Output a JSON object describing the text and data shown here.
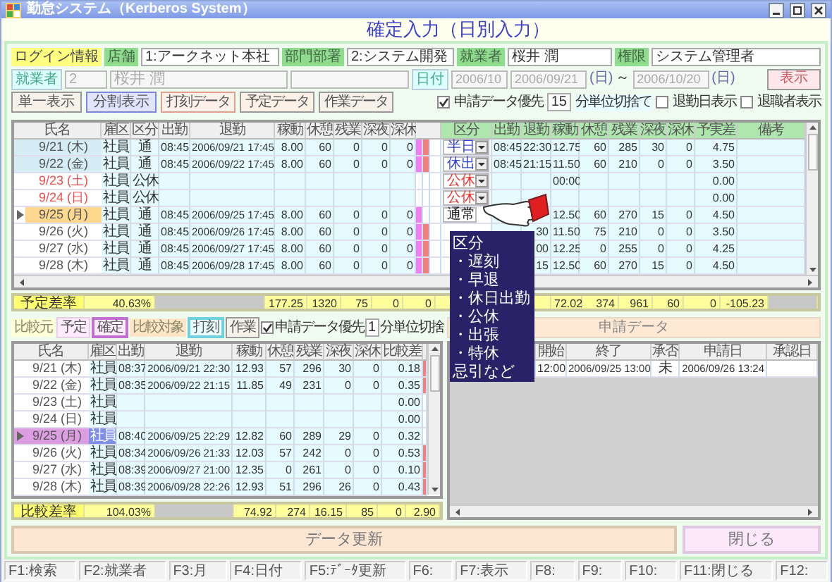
{
  "window": {
    "title": "勤怠システム（Kerberos System）"
  },
  "screen_title": "確定入力（日別入力）",
  "login_info": {
    "label": "ログイン情報",
    "fields": [
      {
        "label": "店舗",
        "value": "1:アークネット本社"
      },
      {
        "label": "部門部署",
        "value": "2:システム開発"
      },
      {
        "label": "就業者",
        "value": "桜井 潤"
      },
      {
        "label": "権限",
        "value": "システム管理者"
      }
    ]
  },
  "filter": {
    "employee_label": "就業者",
    "employee_code": "2",
    "employee_name": "桜井 潤",
    "date_label": "日付",
    "month": "2006/10",
    "date_from": "2006/09/21",
    "from_weekday": "(日)",
    "range_separator": "～",
    "date_to": "2006/10/20",
    "to_weekday": "(日)",
    "show_button": "表示"
  },
  "view_buttons": [
    {
      "label": "単一表示",
      "selected": false
    },
    {
      "label": "分割表示",
      "selected": true
    }
  ],
  "data_buttons": [
    "打刻データ",
    "予定データ",
    "作業データ"
  ],
  "options": {
    "prefer_requests": {
      "label": "申請データ優先",
      "checked": true
    },
    "rounding_value": "15",
    "rounding_label": "分単位切捨て",
    "toggles": [
      {
        "label": "退勤日表示",
        "checked": false
      },
      {
        "label": "退職者表示",
        "checked": false
      }
    ]
  },
  "upper_table": {
    "columns": [
      "氏名",
      "雇区",
      "区分",
      "出勤",
      "退勤",
      "稼動",
      "休憩",
      "残業",
      "深夜",
      "深休"
    ],
    "category_column": "区分",
    "detail_columns": [
      "出勤",
      "退勤",
      "稼動",
      "休憩",
      "残業",
      "深夜",
      "深休",
      "予実差",
      "備考"
    ],
    "rows": [
      {
        "selected": true,
        "current": false,
        "holiday": false,
        "cells": [
          "9/21 (木)",
          "社員",
          "通",
          "08:45",
          "2006/09/21 17:45",
          "8.00",
          "60",
          "0",
          "0",
          "0"
        ],
        "marks": [
          {
            "color": "#f080f0"
          },
          {
            "color": "#f08080"
          }
        ],
        "category": {
          "kind": "dropdown",
          "text": "半日",
          "color": "#3344cc"
        },
        "detail": {
          "in": "08:45",
          "out": "22:30",
          "work": "12.75",
          "rest": "60",
          "overtime": "285",
          "night": "30",
          "night_off": "0",
          "diff": "4.75"
        }
      },
      {
        "selected": true,
        "current": false,
        "holiday": false,
        "cells": [
          "9/22 (金)",
          "社員",
          "通",
          "08:45",
          "2006/09/22 17:45",
          "8.00",
          "60",
          "0",
          "0",
          "0"
        ],
        "marks": [
          {
            "color": "#f080f0"
          },
          {
            "color": "#f08080"
          }
        ],
        "category": {
          "kind": "dropdown",
          "text": "休出",
          "color": "#3344cc"
        },
        "detail": {
          "in": "08:45",
          "out": "21:15",
          "work": "11.50",
          "rest": "60",
          "overtime": "210",
          "night": "0",
          "night_off": "0",
          "diff": "3.50"
        }
      },
      {
        "selected": false,
        "current": false,
        "holiday": true,
        "cells": [
          "9/23 (土)",
          "社員",
          "公休"
        ],
        "category": {
          "kind": "dropdown",
          "text": "公休",
          "color": "#ee3333"
        },
        "detail": {
          "work": "00:00",
          "diff": "0.00"
        }
      },
      {
        "selected": false,
        "current": false,
        "holiday": true,
        "cells": [
          "9/24 (日)",
          "社員",
          "公休"
        ],
        "category": {
          "kind": "dropdown",
          "text": "公休",
          "color": "#ee3333"
        },
        "detail": {
          "diff": "0.00"
        }
      },
      {
        "selected": false,
        "current": true,
        "holiday": false,
        "cells": [
          "9/25 (月)",
          "社員",
          "通",
          "08:45",
          "2006/09/25 17:45",
          "8.00",
          "60",
          "0",
          "0",
          "0"
        ],
        "marks": [
          {
            "color": "#f080f0"
          }
        ],
        "category": {
          "kind": "text",
          "text": "通常",
          "color": "#222222"
        },
        "detail": {
          "work": "12.50",
          "rest": "60",
          "overtime": "270",
          "night": "15",
          "night_off": "0",
          "diff": "4.50"
        }
      },
      {
        "selected": false,
        "current": false,
        "holiday": false,
        "cells": [
          "9/26 (火)",
          "社員",
          "通",
          "08:45",
          "2006/09/26 17:45",
          "8.00",
          "60",
          "0",
          "0",
          "0"
        ],
        "marks": [
          {
            "color": "#f080f0"
          },
          {
            "color": "#f08080"
          }
        ],
        "detail": {
          "out": "30",
          "work": "11.50",
          "rest": "75",
          "overtime": "210",
          "night": "0",
          "night_off": "0",
          "diff": "3.50"
        }
      },
      {
        "selected": false,
        "current": false,
        "holiday": false,
        "cells": [
          "9/27 (水)",
          "社員",
          "通",
          "08:45",
          "2006/09/27 17:45",
          "8.00",
          "60",
          "0",
          "0",
          "0"
        ],
        "marks": [
          {
            "color": "#f080f0"
          },
          {
            "color": "#f08080"
          }
        ],
        "detail": {
          "out": "00",
          "work": "12.25",
          "rest": "0",
          "overtime": "255",
          "night": "0",
          "night_off": "0",
          "diff": "4.25"
        }
      },
      {
        "selected": false,
        "current": false,
        "holiday": false,
        "cells": [
          "9/28 (木)",
          "社員",
          "通",
          "08:45",
          "2006/09/28 17:45",
          "8.00",
          "60",
          "0",
          "0",
          "0"
        ],
        "marks": [
          {
            "color": "#f080f0"
          },
          {
            "color": "#f08080"
          }
        ],
        "detail": {
          "out": "15",
          "work": "12.50",
          "rest": "60",
          "overtime": "270",
          "night": "15",
          "night_off": "0",
          "diff": "4.50"
        }
      }
    ]
  },
  "upper_summary": {
    "label": "予定差率",
    "rate": "40.63%",
    "values": [
      "177.25",
      "1320",
      "75",
      "0",
      "0"
    ],
    "detail_values": [
      "72.02",
      "374",
      "961",
      "60",
      "0",
      "-105.23"
    ]
  },
  "compare": {
    "source_label": "比較元",
    "sources": [
      {
        "label": "予定",
        "selected": false
      },
      {
        "label": "確定",
        "selected": true
      }
    ],
    "target_label": "比較対象",
    "targets": [
      {
        "label": "打刻",
        "selected": true
      },
      {
        "label": "作業",
        "selected": false
      }
    ],
    "prefer_requests": {
      "label": "申請データ優先",
      "checked": true
    },
    "rounding_value": "1",
    "rounding_label": "分単位切捨"
  },
  "lower_table": {
    "columns": [
      "氏名",
      "雇区",
      "出勤",
      "退勤",
      "稼動",
      "休憩",
      "残業",
      "深夜",
      "深休",
      "比較差"
    ],
    "rows": [
      {
        "current": false,
        "cell_selected": false,
        "cells": [
          "9/21 (木)",
          "社員",
          "08:37",
          "2006/09/21 22:30",
          "12.93",
          "57",
          "296",
          "30",
          "0",
          "0.18"
        ],
        "marks": [
          {
            "color": "#f08080"
          }
        ]
      },
      {
        "current": false,
        "cell_selected": false,
        "cells": [
          "9/22 (金)",
          "社員",
          "08:35",
          "2006/09/22 21:15",
          "11.85",
          "49",
          "231",
          "0",
          "0",
          "0.35"
        ],
        "marks": [
          {
            "color": "#f08080"
          }
        ]
      },
      {
        "current": false,
        "cell_selected": false,
        "cells": [
          "9/23 (土)",
          "社員"
        ],
        "difference": "0.00"
      },
      {
        "current": false,
        "cell_selected": false,
        "cells": [
          "9/24 (日)",
          "社員"
        ],
        "difference": "0.00"
      },
      {
        "current": true,
        "cell_selected": true,
        "cells": [
          "9/25 (月)",
          "社員",
          "08:40",
          "2006/09/25 22:29",
          "12.82",
          "60",
          "289",
          "29",
          "0",
          "0.32"
        ]
      },
      {
        "current": false,
        "cell_selected": false,
        "cells": [
          "9/26 (火)",
          "社員",
          "08:34",
          "2006/09/26 21:33",
          "12.03",
          "57",
          "242",
          "0",
          "0",
          "0.53"
        ],
        "marks": [
          {
            "color": "#f08080"
          }
        ]
      },
      {
        "current": false,
        "cell_selected": false,
        "cells": [
          "9/27 (水)",
          "社員",
          "08:39",
          "2006/09/27 21:00",
          "12.35",
          "0",
          "261",
          "0",
          "0",
          "0.10"
        ],
        "marks": [
          {
            "color": "#f08080"
          }
        ]
      },
      {
        "current": false,
        "cell_selected": false,
        "cells": [
          "9/28 (木)",
          "社員",
          "08:39",
          "2006/09/28 22:26",
          "12.93",
          "51",
          "296",
          "26",
          "0",
          "0.43"
        ],
        "marks": [
          {
            "color": "#f08080"
          }
        ]
      }
    ]
  },
  "lower_summary": {
    "label": "比較差率",
    "rate": "104.03%",
    "values": [
      "74.92",
      "274",
      "16.15",
      "85",
      "0",
      "2.90"
    ]
  },
  "requests": {
    "title": "申請データ",
    "columns": [
      "開始",
      "終了",
      "承否",
      "申請日",
      "承認日"
    ],
    "rows": [
      [
        "12:00",
        "2006/09/25 13:00",
        "未",
        "2006/09/26 13:24"
      ]
    ]
  },
  "tooltip": {
    "title": "区分",
    "items": [
      "・遅刻",
      "・早退",
      "・休日出勤",
      "・公休",
      "・出張",
      "・特休"
    ],
    "footer": "忌引など"
  },
  "update_button": "データ更新",
  "close_button": "閉じる",
  "function_keys": [
    "F1:検索",
    "F2:就業者",
    "F3:月",
    "F4:日付",
    "F5:ﾃﾞｰﾀ更新",
    "F6:",
    "F7:表示",
    "F8:",
    "F9:",
    "F10:",
    "F11:閉じる",
    "F12:"
  ]
}
